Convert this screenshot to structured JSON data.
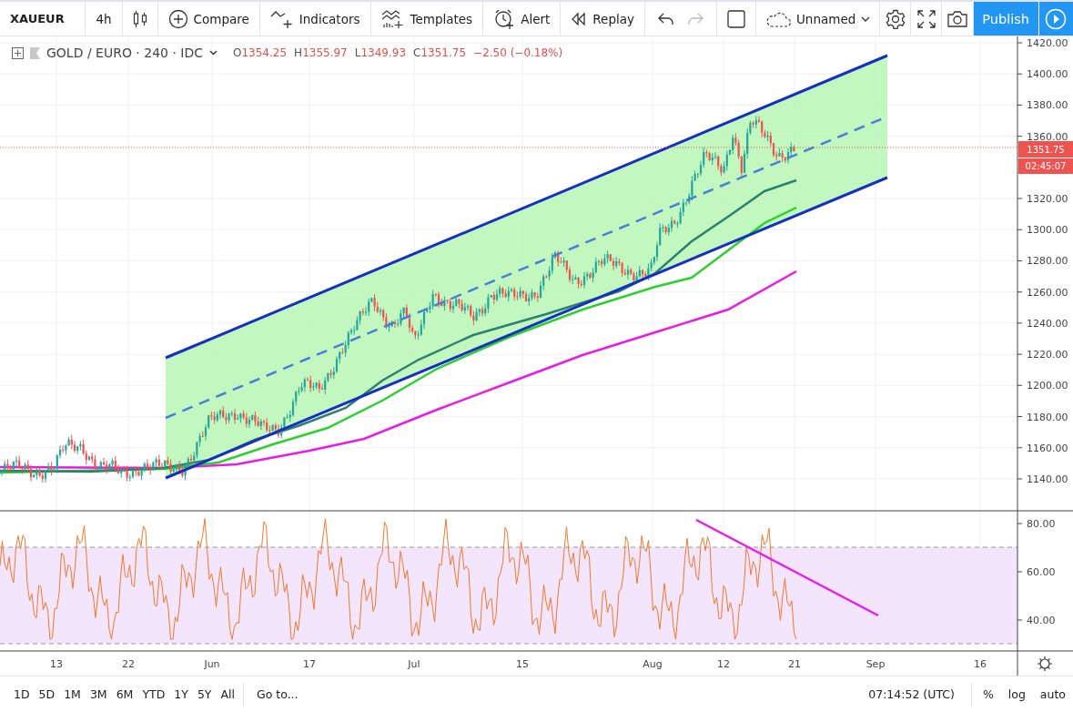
{
  "toolbar": {
    "symbol": "XAUEUR",
    "interval": "4h",
    "buttons": [
      {
        "kind": "compare",
        "label": "Compare"
      },
      {
        "kind": "indicators",
        "label": "Indicators"
      },
      {
        "kind": "templates",
        "label": "Templates"
      },
      {
        "kind": "alert",
        "label": "Alert"
      },
      {
        "kind": "replay",
        "label": "Replay"
      }
    ],
    "layout_name": "Unnamed",
    "publish": "Publish"
  },
  "legend": {
    "title": "GOLD / EURO · 240 · IDC",
    "ohlc": [
      {
        "label": "O",
        "value": "1354.25"
      },
      {
        "label": "H",
        "value": "1355.97"
      },
      {
        "label": "L",
        "value": "1349.93"
      },
      {
        "label": "C",
        "value": "1351.75"
      }
    ],
    "change": "−2.50 (−0.18%)"
  },
  "price_axis": {
    "labels": [
      "1420.00",
      "1400.00",
      "1380.00",
      "1360.00",
      "1320.00",
      "1300.00",
      "1280.00",
      "1260.00",
      "1240.00",
      "1220.00",
      "1200.00",
      "1180.00",
      "1160.00",
      "1140.00"
    ],
    "last_price": "1351.75",
    "countdown": "02:45:07"
  },
  "rsi_axis": {
    "labels": [
      "80.00",
      "60.00",
      "40.00"
    ]
  },
  "time_axis": {
    "labels": [
      "13",
      "22",
      "Jun",
      "17",
      "Jul",
      "15",
      "Aug",
      "12",
      "21",
      "Sep",
      "16"
    ]
  },
  "range_bar": {
    "ranges": [
      "1D",
      "5D",
      "1M",
      "3M",
      "6M",
      "YTD",
      "1Y",
      "5Y",
      "All"
    ],
    "goto": "Go to...",
    "clock": "07:14:52 (UTC)",
    "options": [
      "%",
      "log",
      "auto"
    ]
  }
}
